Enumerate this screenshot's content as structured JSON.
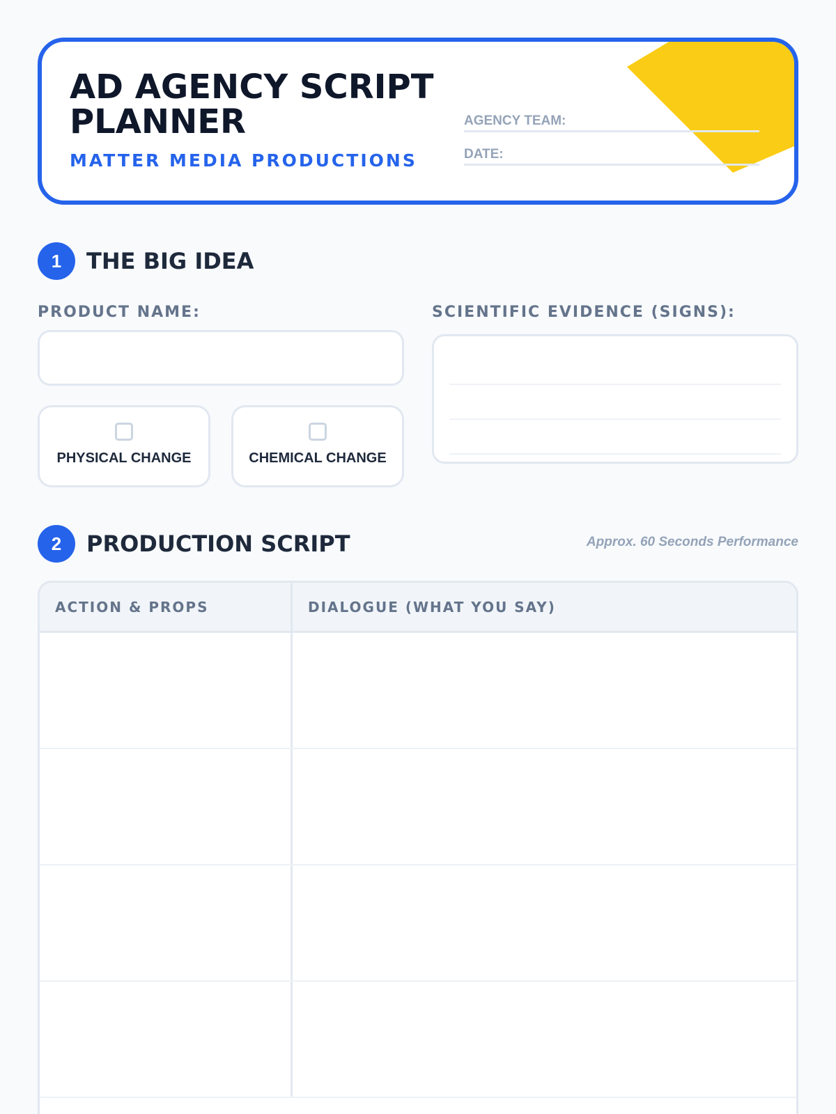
{
  "header": {
    "title": "AD AGENCY SCRIPT PLANNER",
    "subtitle": "MATTER MEDIA PRODUCTIONS",
    "agency_team_label": "AGENCY TEAM:",
    "date_label": "DATE:"
  },
  "colors": {
    "accent": "#2563eb",
    "highlight": "#facc15"
  },
  "section1": {
    "number": "1",
    "title": "THE BIG IDEA",
    "product_name_label": "PRODUCT NAME:",
    "product_name_value": "",
    "evidence_label": "SCIENTIFIC EVIDENCE (SIGNS):",
    "choices": [
      {
        "label": "PHYSICAL CHANGE",
        "checked": false
      },
      {
        "label": "CHEMICAL CHANGE",
        "checked": false
      }
    ]
  },
  "section2": {
    "number": "2",
    "title": "PRODUCTION SCRIPT",
    "note": "Approx. 60 Seconds Performance",
    "columns": [
      "ACTION & PROPS",
      "DIALOGUE (WHAT YOU SAY)"
    ],
    "rows": [
      {
        "action": "",
        "dialogue": ""
      },
      {
        "action": "",
        "dialogue": ""
      },
      {
        "action": "",
        "dialogue": ""
      },
      {
        "action": "",
        "dialogue": ""
      }
    ]
  }
}
